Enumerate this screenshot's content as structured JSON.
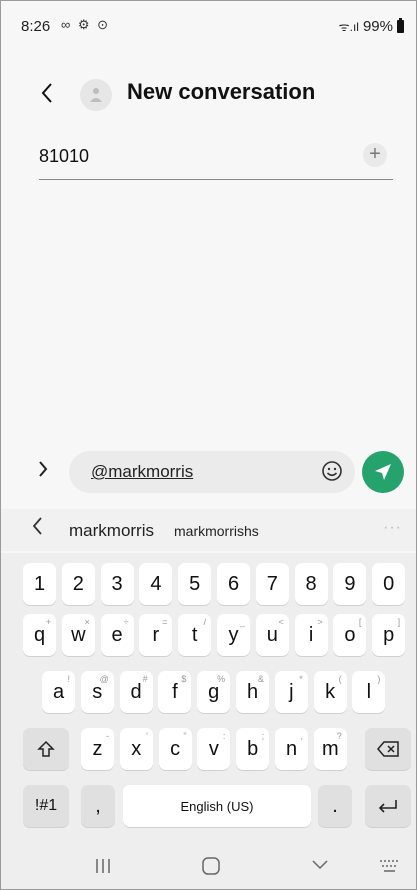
{
  "status_bar": {
    "time": "8:26",
    "left_icons": "∞ ⚙ ⊙",
    "signal": "ᯤ.ıl",
    "battery": "99%"
  },
  "header": {
    "title": "New conversation"
  },
  "recipient": {
    "value": "81010",
    "plus": "+"
  },
  "compose": {
    "text": "@markmorris"
  },
  "suggestions": {
    "primary": "markmorris",
    "secondary": "markmorrishs",
    "more": "···"
  },
  "keyboard": {
    "number_row": [
      "1",
      "2",
      "3",
      "4",
      "5",
      "6",
      "7",
      "8",
      "9",
      "0"
    ],
    "row1": [
      {
        "k": "q",
        "s": "+"
      },
      {
        "k": "w",
        "s": "×"
      },
      {
        "k": "e",
        "s": "÷"
      },
      {
        "k": "r",
        "s": "="
      },
      {
        "k": "t",
        "s": "/"
      },
      {
        "k": "y",
        "s": "_"
      },
      {
        "k": "u",
        "s": "<"
      },
      {
        "k": "i",
        "s": ">"
      },
      {
        "k": "o",
        "s": "["
      },
      {
        "k": "p",
        "s": "]"
      }
    ],
    "row2": [
      {
        "k": "a",
        "s": "!"
      },
      {
        "k": "s",
        "s": "@"
      },
      {
        "k": "d",
        "s": "#"
      },
      {
        "k": "f",
        "s": "$"
      },
      {
        "k": "g",
        "s": "%"
      },
      {
        "k": "h",
        "s": "&"
      },
      {
        "k": "j",
        "s": "*"
      },
      {
        "k": "k",
        "s": "("
      },
      {
        "k": "l",
        "s": ")"
      }
    ],
    "row3": [
      {
        "k": "z",
        "s": "-"
      },
      {
        "k": "x",
        "s": "'"
      },
      {
        "k": "c",
        "s": "\""
      },
      {
        "k": "v",
        "s": ":"
      },
      {
        "k": "b",
        "s": ";"
      },
      {
        "k": "n",
        "s": ","
      },
      {
        "k": "m",
        "s": "?"
      }
    ],
    "symbols_label": "!#1",
    "comma": ",",
    "space_label": "English (US)",
    "period": "."
  },
  "icons": {
    "back": "chevron-left-icon",
    "avatar": "person-icon",
    "send": "send-icon",
    "emoji": "emoji-icon",
    "shift": "shift-icon",
    "backspace": "backspace-icon",
    "enter": "enter-icon"
  },
  "colors": {
    "accent": "#26a36d",
    "background": "#f7f7f7",
    "key": "#ffffff",
    "keyboard": "#eeeeee"
  }
}
